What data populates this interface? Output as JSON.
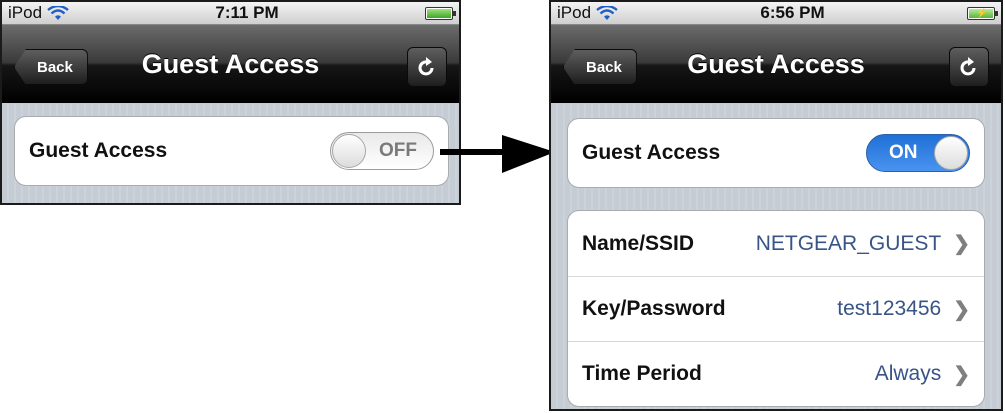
{
  "left_screen": {
    "status": {
      "carrier": "iPod",
      "time": "7:11 PM"
    },
    "nav": {
      "back": "Back",
      "title": "Guest Access"
    },
    "guest_row": {
      "label": "Guest Access",
      "toggle": "OFF"
    }
  },
  "right_screen": {
    "status": {
      "carrier": "iPod",
      "time": "6:56 PM"
    },
    "nav": {
      "back": "Back",
      "title": "Guest Access"
    },
    "guest_row": {
      "label": "Guest Access",
      "toggle": "ON"
    },
    "settings": [
      {
        "label": "Name/SSID",
        "value": "NETGEAR_GUEST"
      },
      {
        "label": "Key/Password",
        "value": "test123456"
      },
      {
        "label": "Time Period",
        "value": "Always"
      }
    ]
  },
  "colors": {
    "toggle_on": "#2a79e0",
    "value_text": "#385487",
    "arrow": "#000000"
  },
  "icons": {
    "wifi": "wifi-icon",
    "battery": "battery-icon",
    "refresh": "refresh-icon",
    "chevron": "chevron-right-icon",
    "arrow": "arrow-right-icon"
  }
}
